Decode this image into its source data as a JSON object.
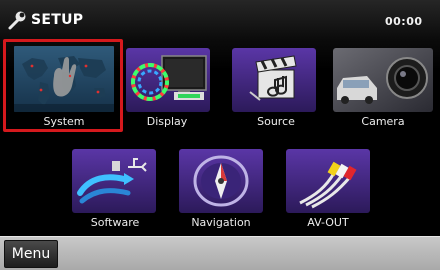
{
  "header": {
    "title": "SETUP",
    "clock": "00:00",
    "icon": "setup-wrench-icon"
  },
  "tiles": [
    {
      "id": "system",
      "label": "System",
      "icon": "world-map-hand-icon",
      "selected": true
    },
    {
      "id": "display",
      "label": "Display",
      "icon": "monitor-color-wheel-icon",
      "selected": false
    },
    {
      "id": "source",
      "label": "Source",
      "icon": "clapperboard-music-icon",
      "selected": false
    },
    {
      "id": "camera",
      "label": "Camera",
      "icon": "rear-view-camera-car-icon",
      "selected": false
    },
    {
      "id": "software",
      "label": "Software",
      "icon": "usb-arrows-icon",
      "selected": false
    },
    {
      "id": "navigation",
      "label": "Navigation",
      "icon": "compass-icon",
      "selected": false
    },
    {
      "id": "avout",
      "label": "AV-OUT",
      "icon": "rca-cable-icon",
      "selected": false
    }
  ],
  "bottom_bar": {
    "menu_label": "Menu"
  },
  "colors": {
    "selection": "#d5191d",
    "tile_purple": "#4a2a8a",
    "bottom_bar": "#b5b5b5"
  }
}
